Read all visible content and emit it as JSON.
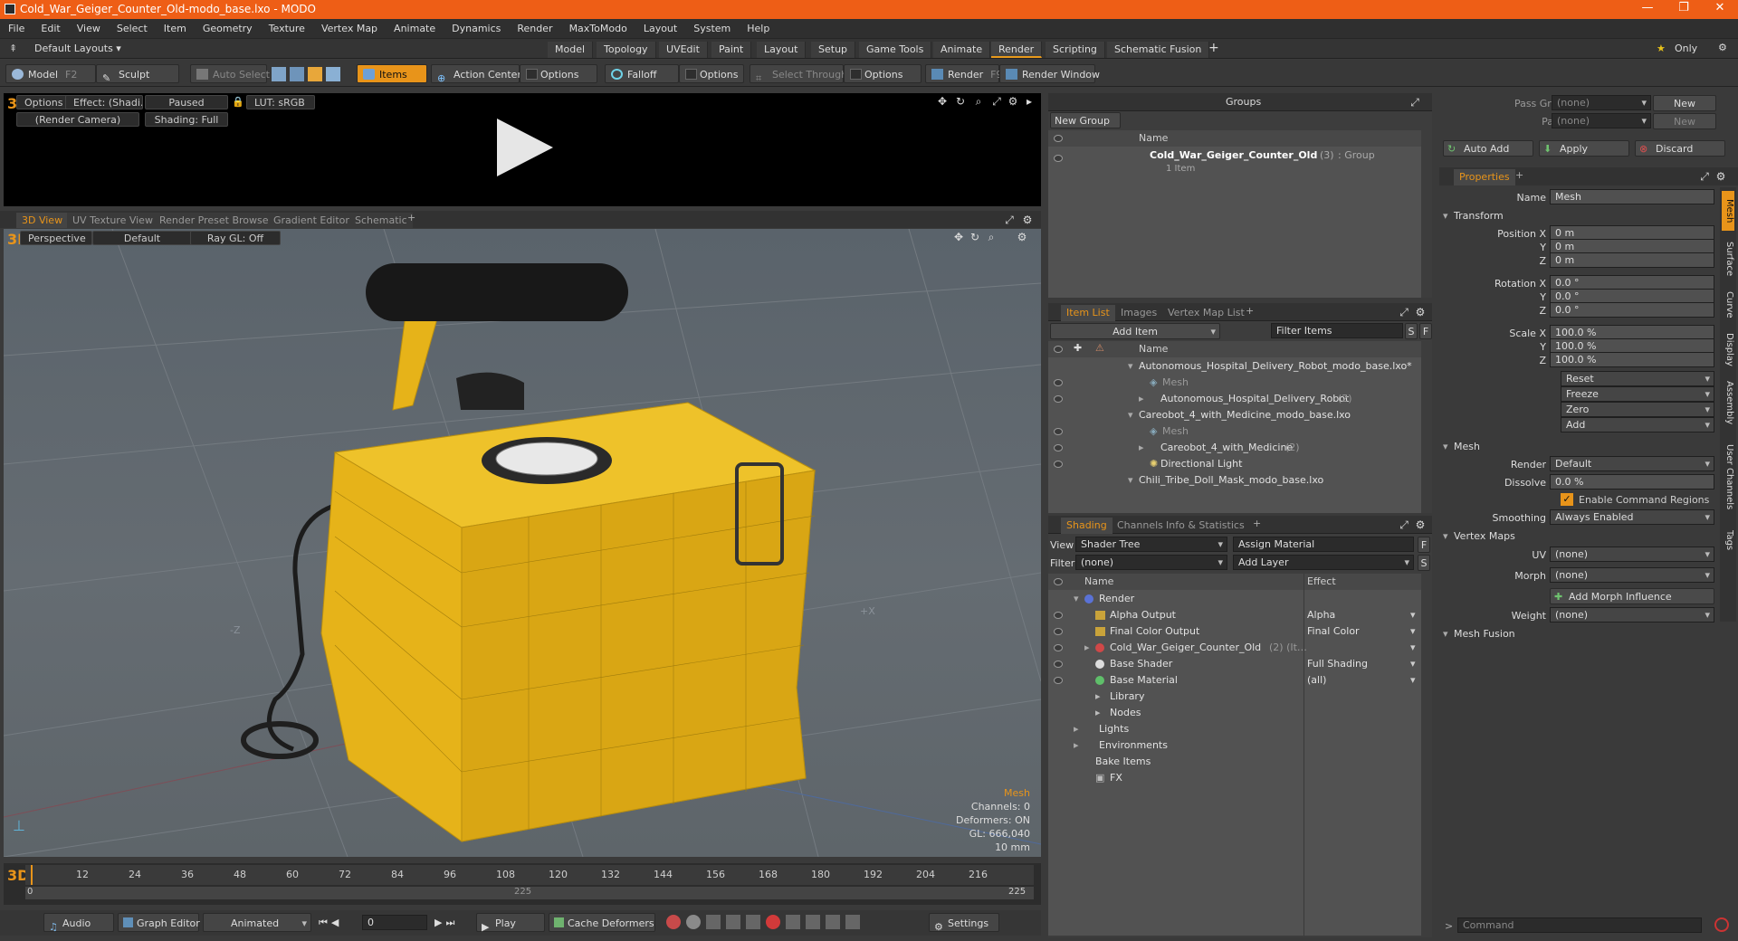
{
  "window": {
    "title": "Cold_War_Geiger_Counter_Old-modo_base.lxo - MODO",
    "min": "—",
    "max": "❐",
    "close": "✕"
  },
  "menu": [
    "File",
    "Edit",
    "View",
    "Select",
    "Item",
    "Geometry",
    "Texture",
    "Vertex Map",
    "Animate",
    "Dynamics",
    "Render",
    "MaxToModo",
    "Layout",
    "System",
    "Help"
  ],
  "layoutbar": {
    "layouts_label": "Default Layouts ▾",
    "tabs": [
      "Model",
      "Topology",
      "UVEdit",
      "Paint",
      "Layout",
      "Setup",
      "Game Tools",
      "Animate",
      "Render",
      "Scripting",
      "Schematic Fusion"
    ],
    "active_tab": "Render",
    "plus": "+",
    "only": "Only"
  },
  "toolbar": {
    "model": "Model",
    "model_key": "F2",
    "sculpt": "Sculpt",
    "auto_select": "Auto Select",
    "items": "Items",
    "action_center": "Action Center",
    "options1": "Options",
    "falloff": "Falloff",
    "options2": "Options",
    "select_through": "Select Through",
    "options3": "Options",
    "render": "Render",
    "render_key": "F9",
    "render_window": "Render Window"
  },
  "renderview": {
    "options": "Options",
    "effect": "Effect: (Shadi…",
    "paused": "Paused",
    "lut": "LUT: sRGB",
    "camera": "(Render Camera)",
    "shading": "Shading: Full"
  },
  "viewtabs": {
    "tabs": [
      "3D View",
      "UV Texture View",
      "Render Preset Browser",
      "Gradient Editor",
      "Schematic"
    ],
    "plus": "+"
  },
  "viewport": {
    "perspective": "Perspective",
    "default": "Default",
    "raygl": "Ray GL: Off",
    "hud": {
      "title": "Mesh",
      "channels": "Channels: 0",
      "deformers": "Deformers: ON",
      "gl": "GL: 666,040",
      "size": "10 mm"
    },
    "axis_neg_z": "-Z",
    "axis_x": "+X"
  },
  "timeline": {
    "ticks": [
      "0",
      "12",
      "24",
      "36",
      "48",
      "60",
      "72",
      "84",
      "96",
      "108",
      "120",
      "132",
      "144",
      "156",
      "168",
      "180",
      "192",
      "204",
      "216"
    ],
    "start": "0",
    "end": "225",
    "mid": "225",
    "end2": "225"
  },
  "bottombar": {
    "audio": "Audio",
    "graph_editor": "Graph Editor",
    "animated": "Animated",
    "frame": "0",
    "play": "Play",
    "cache": "Cache Deformers",
    "settings": "Settings"
  },
  "groups": {
    "title": "Groups",
    "new_group": "New Group",
    "col_name": "Name",
    "item": {
      "name": "Cold_War_Geiger_Counter_Old",
      "count": "(3)",
      "type": ": Group",
      "sub": "1 Item"
    }
  },
  "itemlist": {
    "tabs": [
      "Item List",
      "Images",
      "Vertex Map List"
    ],
    "plus": "+",
    "add_item": "Add Item",
    "filter": "Filter Items",
    "s": "S",
    "f": "F",
    "col_name": "Name",
    "rows": [
      {
        "t": "Autonomous_Hospital_Delivery_Robot_modo_base.lxo*",
        "indent": 0,
        "kind": "scene"
      },
      {
        "t": "Mesh",
        "indent": 2,
        "kind": "mesh"
      },
      {
        "t": "Autonomous_Hospital_Delivery_Robot",
        "cnt": "(2)",
        "indent": 1,
        "kind": "group"
      },
      {
        "t": "Careobot_4_with_Medicine_modo_base.lxo",
        "indent": 0,
        "kind": "scene"
      },
      {
        "t": "Mesh",
        "indent": 2,
        "kind": "mesh"
      },
      {
        "t": "Careobot_4_with_Medicine",
        "cnt": "(2)",
        "indent": 1,
        "kind": "group"
      },
      {
        "t": "Directional Light",
        "indent": 1,
        "kind": "light"
      },
      {
        "t": "Chili_Tribe_Doll_Mask_modo_base.lxo",
        "indent": 0,
        "kind": "scene"
      }
    ]
  },
  "shading": {
    "tabs": [
      "Shading",
      "Channels",
      "Info & Statistics"
    ],
    "plus": "+",
    "view_label": "View",
    "view_val": "Shader Tree",
    "assign": "Assign Material",
    "f": "F",
    "filter_label": "Filter",
    "filter_val": "(none)",
    "add_layer": "Add Layer",
    "s": "S",
    "col_name": "Name",
    "col_effect": "Effect",
    "rows": [
      {
        "t": "Render",
        "e": "",
        "indent": 0
      },
      {
        "t": "Alpha Output",
        "e": "Alpha",
        "indent": 1
      },
      {
        "t": "Final Color Output",
        "e": "Final Color",
        "indent": 1
      },
      {
        "t": "Cold_War_Geiger_Counter_Old",
        "cnt": "(2) (It…",
        "e": "",
        "indent": 1
      },
      {
        "t": "Base Shader",
        "e": "Full Shading",
        "indent": 1
      },
      {
        "t": "Base Material",
        "e": "(all)",
        "indent": 1
      },
      {
        "t": "Library",
        "e": "",
        "indent": 1
      },
      {
        "t": "Nodes",
        "e": "",
        "indent": 1
      },
      {
        "t": "Lights",
        "e": "",
        "indent": 0
      },
      {
        "t": "Environments",
        "e": "",
        "indent": 0
      },
      {
        "t": "Bake Items",
        "e": "",
        "indent": 0
      },
      {
        "t": "FX",
        "e": "",
        "indent": 0
      }
    ]
  },
  "passes": {
    "pass_groups": "Pass Groups",
    "pass_groups_val": "(none)",
    "passes": "Passes",
    "passes_val": "(none)",
    "new1": "New",
    "new2": "New",
    "auto_add": "Auto Add",
    "apply": "Apply",
    "discard": "Discard"
  },
  "properties": {
    "tab": "Properties",
    "plus": "+",
    "name_label": "Name",
    "name_val": "Mesh",
    "transform": "Transform",
    "pos_label": "Position X",
    "pos": [
      "0 m",
      "0 m",
      "0 m"
    ],
    "rot_label": "Rotation X",
    "rot": [
      "0.0 °",
      "0.0 °",
      "0.0 °"
    ],
    "scale_label": "Scale X",
    "scale": [
      "100.0 %",
      "100.0 %",
      "100.0 %"
    ],
    "y": "Y",
    "z": "Z",
    "reset": "Reset",
    "freeze": "Freeze",
    "zero": "Zero",
    "add": "Add",
    "mesh": "Mesh",
    "render_label": "Render",
    "render_val": "Default",
    "dissolve_label": "Dissolve",
    "dissolve_val": "0.0 %",
    "enable_cmd": "Enable Command Regions",
    "smoothing_label": "Smoothing",
    "smoothing_val": "Always Enabled",
    "vertex_maps": "Vertex Maps",
    "uv_label": "UV",
    "uv_val": "(none)",
    "morph_label": "Morph",
    "morph_val": "(none)",
    "add_morph": "Add Morph Influence",
    "weight_label": "Weight",
    "weight_val": "(none)",
    "mesh_fusion": "Mesh Fusion",
    "side_tabs": [
      "Mesh",
      "Surface",
      "Curve",
      "Display",
      "Assembly",
      "User Channels",
      "Tags"
    ],
    "command": "Command"
  },
  "colors": {
    "accent": "#e8941a",
    "title": "#ee5e16",
    "yellow": "#e6b319"
  }
}
